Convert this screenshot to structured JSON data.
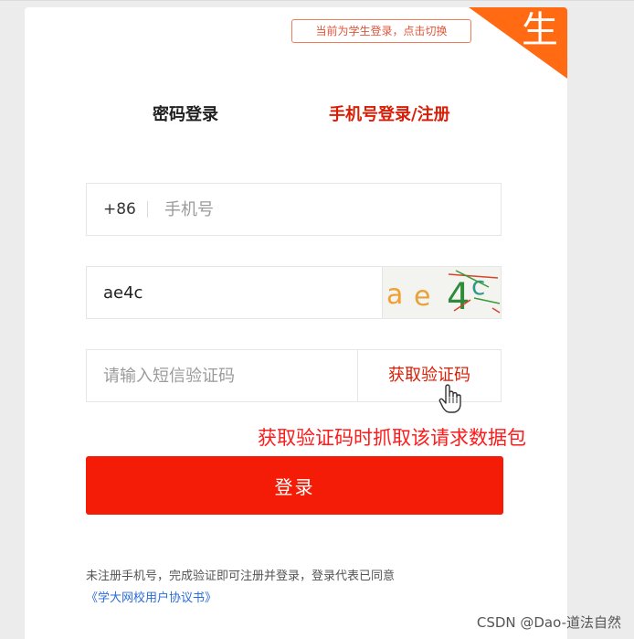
{
  "switch_badge": "当前为学生登录，点击切换",
  "corner_label": "生",
  "tabs": {
    "password": "密码登录",
    "phone": "手机号登录/注册"
  },
  "phone": {
    "country_code": "+86",
    "placeholder": "手机号"
  },
  "captcha": {
    "value": "ae4c",
    "image_text": [
      "a",
      "e",
      "4",
      "c"
    ]
  },
  "sms": {
    "placeholder": "请输入短信验证码",
    "button": "获取验证码"
  },
  "annotation": "获取验证码时抓取该请求数据包",
  "login_button": "登录",
  "agreement": {
    "text": "未注册手机号，完成验证即可注册并登录，登录代表已同意",
    "link": "《学大网校用户协议书》"
  },
  "watermark": "CSDN @Dao-道法自然",
  "colors": {
    "accent": "#d81e06",
    "button": "#f41c06",
    "corner": "#ff6a13",
    "link": "#2a6dd8"
  }
}
